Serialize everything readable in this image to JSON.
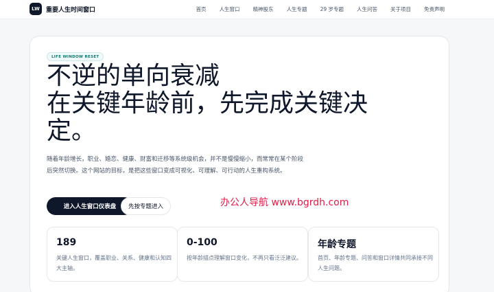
{
  "header": {
    "logo_text": "LW",
    "site_name": "重要人生时间窗口",
    "nav": [
      "首页",
      "人生窗口",
      "精神股东",
      "人生专题",
      "29 岁专题",
      "人生问答",
      "关于项目",
      "免责声明"
    ]
  },
  "hero": {
    "tag": "LIFE WINDOW RESET",
    "headline_lines": [
      "不逆的单向衰减",
      "在关键年龄前，先完成关键决",
      "定。"
    ],
    "description": "随着年龄增长，职业、婚恋、健康、财富和迁移等系统级机会，并不是慢慢缩小，而常常在某个阶段后突然切换。这个网站的目标，是把这些窗口变成可视化、可理解、可行动的人生重构系统。",
    "primary_button": "进入人生窗口仪表盘",
    "secondary_button": "先按专题进入",
    "watermark": "办公人导航  www.bgrdh.com"
  },
  "stats": [
    {
      "title": "189",
      "text": "关键人生窗口，覆盖职业、关系、健康和认知四大主轴。"
    },
    {
      "title": "0-100",
      "text": "按年龄描点理解窗口变化，不再只看泛泛建议。"
    },
    {
      "title": "年龄专题",
      "text": "首页、年龄专题、问答和窗口详情共同承接不同人生问题。"
    }
  ],
  "colors": {
    "primary": "#0f172a",
    "tag_text": "#0f766e",
    "tag_bg": "#eefaf9",
    "watermark": "#e11d48"
  }
}
